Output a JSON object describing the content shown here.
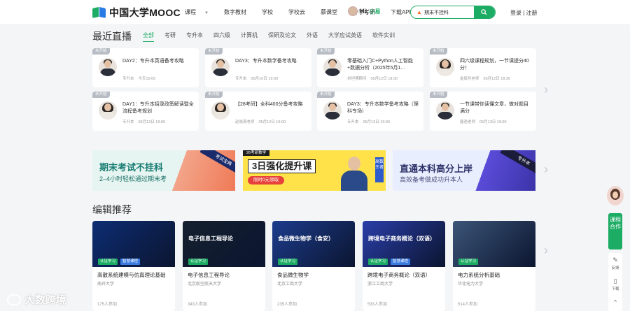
{
  "header": {
    "logo_text": "中国大学MOOC",
    "nav": [
      {
        "label": "课程",
        "has_caret": true
      },
      {
        "label": "数字教材",
        "has_caret": false
      },
      {
        "label": "学校",
        "has_caret": false
      },
      {
        "label": "学校云",
        "has_caret": false
      },
      {
        "label": "慕课堂",
        "has_caret": false
      },
      {
        "label": "升学考研",
        "has_caret": false
      },
      {
        "label": "下载APP",
        "has_caret": true
      }
    ],
    "greeting": "Hi,",
    "user_name": "小易",
    "search_value": "期末不挂科",
    "login_label": "登录 | 注册"
  },
  "live": {
    "title": "最近直播",
    "tabs": [
      "全部",
      "考研",
      "专升本",
      "四六级",
      "计算机",
      "保研及论文",
      "外语",
      "大学应试英语",
      "软件实训"
    ],
    "active_tab": 0,
    "cards": [
      {
        "badge": "未开始",
        "title": "DAY2：专升本英语备考攻略",
        "author": "专升本",
        "time": "今天19:00",
        "gender": "m"
      },
      {
        "badge": "未开始",
        "title": "DAY3：专升本数学备考攻略",
        "author": "专升本",
        "time": "05月10日 19:00",
        "gender": "m"
      },
      {
        "badge": "未开始",
        "title": "零基础入门C+Python人工智能+数据分析（2025年5月1...",
        "author": "刘坦博顾问",
        "time": "05月12日 18:30",
        "gender": "m"
      },
      {
        "badge": "未开始",
        "title": "四六级课程规划，一节课提分40分！",
        "author": "金辰月老师",
        "time": "05月12日 18:30",
        "gender": "f"
      },
      {
        "badge": "未开始",
        "title": "DAY1：专升本招录政策解读暨全流程备考规划",
        "author": "专升本",
        "time": "05月12日 19:00",
        "gender": "f"
      },
      {
        "badge": "未开始",
        "title": "【28考研】全科400分备考攻略",
        "author": "赵晓燕老师",
        "time": "05月12日 19:00",
        "gender": "f"
      },
      {
        "badge": "未开始",
        "title": "DAY3：专升本数学备考攻略（理科专场）",
        "author": "专升本",
        "time": "05月13日 19:00",
        "gender": "m"
      },
      {
        "badge": "未开始",
        "title": "一节课带你读懂文章，做对题目满分",
        "author": "唐语老师",
        "time": "05月13日 19:00",
        "gender": "m"
      }
    ]
  },
  "banners": [
    {
      "big": "期末考试不挂科",
      "small": "2–4小时轻松通过期末考",
      "corner": "考试宝典"
    },
    {
      "tag": "26考研数学",
      "big": "3日强化提升课",
      "pill": "限时0元领取",
      "side": "高数王者"
    },
    {
      "big": "直通本科高分上岸",
      "small": "高效备考做成功升本人",
      "corner": "专升本"
    }
  ],
  "recommend": {
    "title": "编辑推荐",
    "courses": [
      {
        "name": "高散系统建模与仿真理论基础",
        "school": "南开大学",
        "count": "175人参加",
        "chip": "认证学习",
        "chip2": "智慧课程",
        "cover_title": "",
        "cover_color": "#0d2d73"
      },
      {
        "name": "电子信息工程导论",
        "school": "北京航空航天大学",
        "count": "343人参加",
        "chip": "认证学习",
        "chip2": "",
        "cover_title": "电子信息工程导论",
        "cover_color": "#14202e"
      },
      {
        "name": "食品微生物学",
        "school": "北京工商大学",
        "count": "235人参加",
        "chip": "认证学习",
        "chip2": "",
        "cover_title": "食品微生物学（食安）",
        "cover_color": "#1c3c8c"
      },
      {
        "name": "跨境电子商务概论（双语）",
        "school": "浙江工商大学",
        "count": "533人参加",
        "chip": "认证学习",
        "chip2": "智慧课程",
        "cover_title": "跨境电子商务概论（双语）",
        "cover_color": "#2a3ea8"
      },
      {
        "name": "电力系统分析基础",
        "school": "华北电力大学",
        "count": "514人参加",
        "chip": "认证学习",
        "chip2": "",
        "cover_title": "",
        "cover_color": "#3c5578"
      }
    ]
  },
  "floaters": {
    "green_label": "课程合作",
    "tools": [
      {
        "icon": "feedback-icon",
        "label": "反馈"
      },
      {
        "icon": "download-icon",
        "label": "下载"
      }
    ]
  },
  "watermark": "大数跨境",
  "colors": {
    "brand_green": "#1dac64",
    "brand_blue": "#2a7be4"
  }
}
